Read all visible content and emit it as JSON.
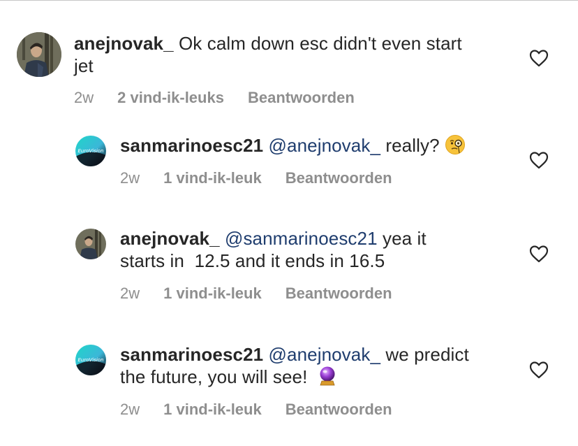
{
  "comments": [
    {
      "username": "anejnovak_",
      "mention": "",
      "text_line1": "Ok calm down esc didn't even start",
      "text_line2": "jet",
      "time": "2w",
      "likes": "2 vind-ik-leuks",
      "reply": "Beantwoorden",
      "avatar": "person-photo"
    },
    {
      "username": "sanmarinoesc21",
      "mention": "@anejnovak_",
      "text_line1": "really?",
      "text_line2": "",
      "emoji": "monocle-face-emoji",
      "time": "2w",
      "likes": "1 vind-ik-leuk",
      "reply": "Beantwoorden",
      "avatar": "eurovision-logo"
    },
    {
      "username": "anejnovak_",
      "mention": "@sanmarinoesc21",
      "text_line1": "yea it",
      "text_line2": "starts in  12.5 and it ends in 16.5",
      "time": "2w",
      "likes": "1 vind-ik-leuk",
      "reply": "Beantwoorden",
      "avatar": "person-photo"
    },
    {
      "username": "sanmarinoesc21",
      "mention": "@anejnovak_",
      "text_line1": "we predict",
      "text_line2": "the future, you will see!",
      "emoji": "crystal-ball-emoji",
      "time": "2w",
      "likes": "1 vind-ik-leuk",
      "reply": "Beantwoorden",
      "avatar": "eurovision-logo"
    }
  ],
  "colors": {
    "text": "#262626",
    "mention": "#1f3d6e",
    "meta": "#8e8e8e",
    "heart": "#262626"
  },
  "icons": {
    "like": "heart-outline-icon"
  }
}
